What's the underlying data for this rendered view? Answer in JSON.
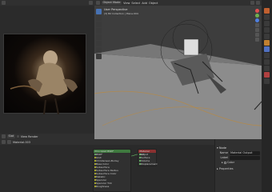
{
  "top_left_header": {
    "pin_label": ""
  },
  "viewport_header": {
    "mode": "Object Mode",
    "menus": [
      "View",
      "Select",
      "Add",
      "Object"
    ]
  },
  "viewport": {
    "perspective_label": "User Perspective",
    "collection_label": "(3) Bd Collection | Plane.004"
  },
  "render_image": {
    "caption": ""
  },
  "image_editor_header": {
    "items": [
      "Slot",
      "View Render"
    ]
  },
  "node_editor_header": {
    "material": "Material.003"
  },
  "nodes": {
    "principled": {
      "title": "Principled BSDF",
      "rows": [
        "BSDF",
        "GGX",
        "Christensen-Burley",
        "Base Color",
        "Subsurface",
        "Subsurface Radius",
        "Subsurface Color",
        "Metallic",
        "Specular",
        "Specular Tint",
        "Roughness"
      ]
    },
    "output": {
      "title": "Material Output",
      "rows": [
        "All",
        "Surface",
        "Volume",
        "Displacement"
      ]
    }
  },
  "properties": {
    "section": "Node",
    "name_label": "Name",
    "name_value": "Material Output",
    "label_label": "Label",
    "color_label": "Color",
    "properties_label": "Properties"
  },
  "colors": {
    "accent": "#4772b3",
    "node_green": "#3f7a3f",
    "node_red": "#8a3030"
  }
}
